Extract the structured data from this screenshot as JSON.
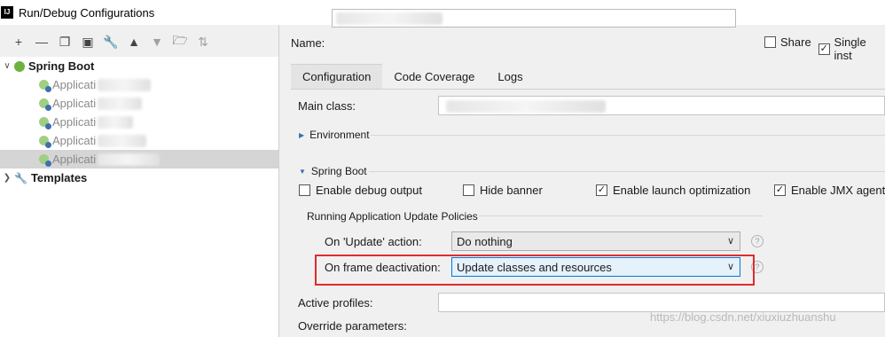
{
  "window": {
    "title": "Run/Debug Configurations",
    "app_icon": "IJ"
  },
  "toolbar": {
    "icons": [
      "add-icon",
      "remove-icon",
      "copy-icon",
      "save-icon",
      "wrench-icon",
      "move-up-icon",
      "move-down-icon",
      "folder-icon",
      "sort-icon"
    ]
  },
  "tree": {
    "root_label": "Spring Boot",
    "children": [
      "Applicati",
      "Applicati",
      "Applicati",
      "Applicati",
      "Applicati"
    ],
    "templates_label": "Templates"
  },
  "header": {
    "name_label": "Name:",
    "share_label": "Share",
    "single_label": "Single inst"
  },
  "tabs": [
    "Configuration",
    "Code Coverage",
    "Logs"
  ],
  "config": {
    "main_class_label": "Main class:",
    "environment_label": "Environment",
    "spring_boot_label": "Spring Boot",
    "debug_output_label": "Enable debug output",
    "hide_banner_label": "Hide banner",
    "launch_opt_label": "Enable launch optimization",
    "jmx_label": "Enable JMX agent",
    "policies_label": "Running Application Update Policies",
    "update_action_label": "On 'Update' action:",
    "update_action_value": "Do nothing",
    "frame_deactivation_label": "On frame deactivation:",
    "frame_deactivation_value": "Update classes and resources",
    "active_profiles_label": "Active profiles:",
    "override_params_label": "Override parameters:"
  },
  "checks": {
    "share": false,
    "single": true,
    "debug_output": false,
    "hide_banner": false,
    "launch_opt": true,
    "jmx": true
  },
  "watermark": "https://blog.csdn.net/xiuxiuzhuanshu",
  "colors": {
    "highlight": "#e02b2b",
    "selection": "#d5d5d5",
    "spring_green": "#6cb33e"
  }
}
